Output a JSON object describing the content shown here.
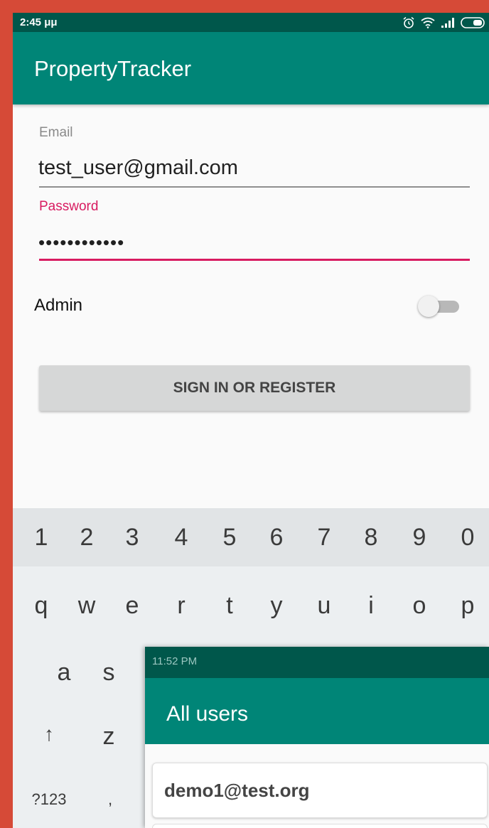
{
  "status_bar": {
    "time": "2:45 μμ"
  },
  "app_bar": {
    "title": "PropertyTracker"
  },
  "login_form": {
    "email_label": "Email",
    "email_value": "test_user@gmail.com",
    "password_label": "Password",
    "password_value": "••••••••••••",
    "admin_label": "Admin",
    "admin_toggle_on": false,
    "submit_label": "SIGN IN OR REGISTER"
  },
  "keyboard": {
    "number_row": [
      "1",
      "2",
      "3",
      "4",
      "5",
      "6",
      "7",
      "8",
      "9",
      "0"
    ],
    "letter_row_1": [
      "q",
      "w",
      "e",
      "r",
      "t",
      "y",
      "u",
      "i",
      "o",
      "p"
    ],
    "letter_row_2": [
      "a",
      "s"
    ],
    "letter_row_3": [
      "↑",
      "z"
    ],
    "bottom_row": [
      "?123",
      ","
    ]
  },
  "overlay_screen": {
    "time": "11:52 PM",
    "title": "All users",
    "users": [
      "demo1@test.org"
    ]
  },
  "colors": {
    "background": "#D64A37",
    "primary": "#008577",
    "primary_dark": "#00574B",
    "accent": "#D81B60"
  }
}
